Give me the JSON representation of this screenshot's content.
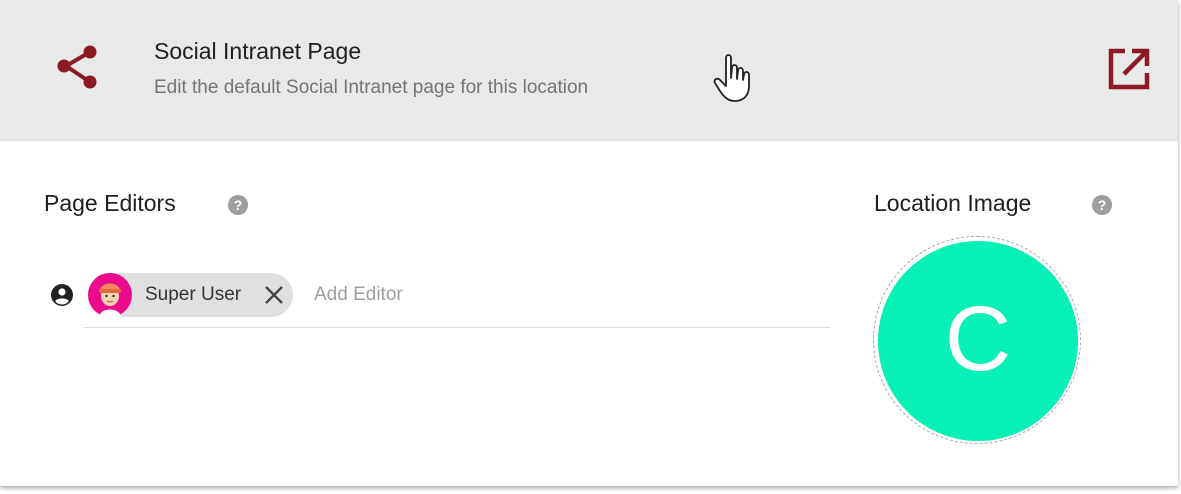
{
  "header": {
    "title": "Social Intranet Page",
    "subtitle": "Edit the default Social Intranet page for this location",
    "share_icon": "share-icon",
    "open_icon": "open-in-new-icon"
  },
  "editors": {
    "title": "Page Editors",
    "help_icon": "help-icon",
    "chips": [
      {
        "label": "Super User",
        "avatar": "avatar",
        "remove_icon": "close-icon"
      }
    ],
    "input_placeholder": "Add Editor",
    "input_value": ""
  },
  "location_image": {
    "title": "Location Image",
    "initial": "C",
    "color": "#07f0b5"
  },
  "colors": {
    "accent": "#8b1a24",
    "header_bg": "#e9e9e9",
    "image_bg": "#07f0b5"
  }
}
